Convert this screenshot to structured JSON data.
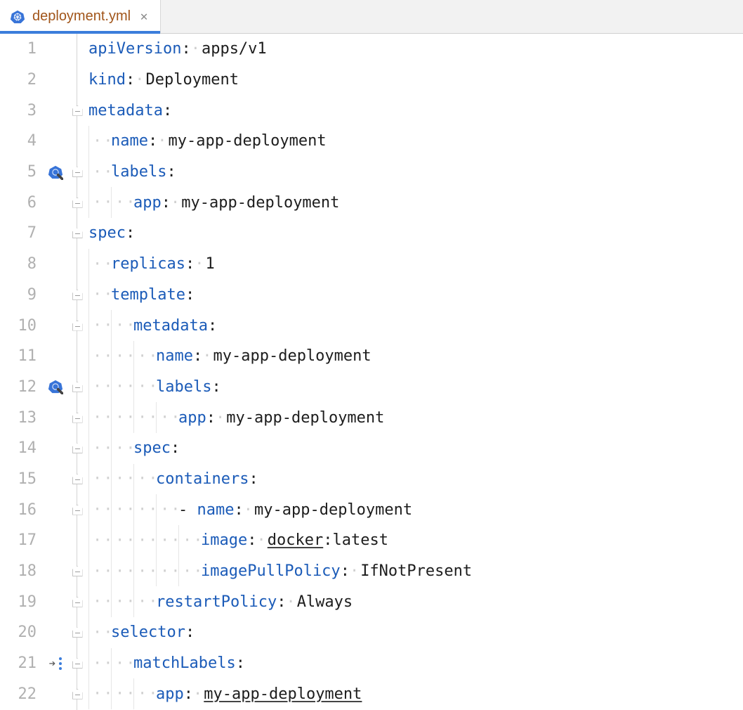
{
  "tab": {
    "filename": "deployment.yml"
  },
  "colors": {
    "key": "#1b5bb8",
    "accent": "#3b7ddb",
    "tab_label": "#a1551a"
  },
  "gutter_icons": {
    "5": "k8s-edit-icon",
    "12": "k8s-edit-icon",
    "21": "change-marker-icon"
  },
  "fold_handles_at": [
    3,
    5,
    6,
    7,
    9,
    10,
    12,
    13,
    14,
    15,
    16,
    18,
    19,
    20,
    21,
    22
  ],
  "lines": [
    {
      "n": 1,
      "indent": 0,
      "segs": [
        {
          "t": "key",
          "v": "apiVersion"
        },
        {
          "t": "punct",
          "v": ":"
        },
        {
          "t": "ws",
          "v": " "
        },
        {
          "t": "val",
          "v": "apps/v1"
        }
      ]
    },
    {
      "n": 2,
      "indent": 0,
      "segs": [
        {
          "t": "key",
          "v": "kind"
        },
        {
          "t": "punct",
          "v": ":"
        },
        {
          "t": "ws",
          "v": " "
        },
        {
          "t": "val",
          "v": "Deployment"
        }
      ]
    },
    {
      "n": 3,
      "indent": 0,
      "segs": [
        {
          "t": "key",
          "v": "metadata"
        },
        {
          "t": "punct",
          "v": ":"
        }
      ]
    },
    {
      "n": 4,
      "indent": 1,
      "segs": [
        {
          "t": "key",
          "v": "name"
        },
        {
          "t": "punct",
          "v": ":"
        },
        {
          "t": "ws",
          "v": " "
        },
        {
          "t": "val",
          "v": "my-app-deployment"
        }
      ]
    },
    {
      "n": 5,
      "indent": 1,
      "segs": [
        {
          "t": "key",
          "v": "labels"
        },
        {
          "t": "punct",
          "v": ":"
        }
      ]
    },
    {
      "n": 6,
      "indent": 2,
      "segs": [
        {
          "t": "key",
          "v": "app"
        },
        {
          "t": "punct",
          "v": ":"
        },
        {
          "t": "ws",
          "v": " "
        },
        {
          "t": "val",
          "v": "my-app-deployment"
        }
      ]
    },
    {
      "n": 7,
      "indent": 0,
      "segs": [
        {
          "t": "key",
          "v": "spec"
        },
        {
          "t": "punct",
          "v": ":"
        }
      ]
    },
    {
      "n": 8,
      "indent": 1,
      "segs": [
        {
          "t": "key",
          "v": "replicas"
        },
        {
          "t": "punct",
          "v": ":"
        },
        {
          "t": "ws",
          "v": " "
        },
        {
          "t": "val",
          "v": "1"
        }
      ]
    },
    {
      "n": 9,
      "indent": 1,
      "segs": [
        {
          "t": "key",
          "v": "template"
        },
        {
          "t": "punct",
          "v": ":"
        }
      ]
    },
    {
      "n": 10,
      "indent": 2,
      "segs": [
        {
          "t": "key",
          "v": "metadata"
        },
        {
          "t": "punct",
          "v": ":"
        }
      ]
    },
    {
      "n": 11,
      "indent": 3,
      "segs": [
        {
          "t": "key",
          "v": "name"
        },
        {
          "t": "punct",
          "v": ":"
        },
        {
          "t": "ws",
          "v": " "
        },
        {
          "t": "val",
          "v": "my-app-deployment"
        }
      ]
    },
    {
      "n": 12,
      "indent": 3,
      "segs": [
        {
          "t": "key",
          "v": "labels"
        },
        {
          "t": "punct",
          "v": ":"
        }
      ]
    },
    {
      "n": 13,
      "indent": 4,
      "segs": [
        {
          "t": "key",
          "v": "app"
        },
        {
          "t": "punct",
          "v": ":"
        },
        {
          "t": "ws",
          "v": " "
        },
        {
          "t": "val",
          "v": "my-app-deployment"
        }
      ]
    },
    {
      "n": 14,
      "indent": 2,
      "segs": [
        {
          "t": "key",
          "v": "spec"
        },
        {
          "t": "punct",
          "v": ":"
        }
      ]
    },
    {
      "n": 15,
      "indent": 3,
      "segs": [
        {
          "t": "key",
          "v": "containers"
        },
        {
          "t": "punct",
          "v": ":"
        }
      ]
    },
    {
      "n": 16,
      "indent": 4,
      "segs": [
        {
          "t": "dash",
          "v": "- "
        },
        {
          "t": "key",
          "v": "name"
        },
        {
          "t": "punct",
          "v": ":"
        },
        {
          "t": "ws",
          "v": " "
        },
        {
          "t": "val",
          "v": "my-app-deployment"
        }
      ]
    },
    {
      "n": 17,
      "indent": 5,
      "segs": [
        {
          "t": "key",
          "v": "image"
        },
        {
          "t": "punct",
          "v": ":"
        },
        {
          "t": "ws",
          "v": " "
        },
        {
          "t": "val-u",
          "v": "docker"
        },
        {
          "t": "val",
          "v": ":latest"
        }
      ]
    },
    {
      "n": 18,
      "indent": 5,
      "segs": [
        {
          "t": "key",
          "v": "imagePullPolicy"
        },
        {
          "t": "punct",
          "v": ":"
        },
        {
          "t": "ws",
          "v": " "
        },
        {
          "t": "val",
          "v": "IfNotPresent"
        }
      ]
    },
    {
      "n": 19,
      "indent": 3,
      "segs": [
        {
          "t": "key",
          "v": "restartPolicy"
        },
        {
          "t": "punct",
          "v": ":"
        },
        {
          "t": "ws",
          "v": " "
        },
        {
          "t": "val",
          "v": "Always"
        }
      ]
    },
    {
      "n": 20,
      "indent": 1,
      "segs": [
        {
          "t": "key",
          "v": "selector"
        },
        {
          "t": "punct",
          "v": ":"
        }
      ]
    },
    {
      "n": 21,
      "indent": 2,
      "segs": [
        {
          "t": "key",
          "v": "matchLabels"
        },
        {
          "t": "punct",
          "v": ":"
        }
      ]
    },
    {
      "n": 22,
      "indent": 3,
      "segs": [
        {
          "t": "key",
          "v": "app"
        },
        {
          "t": "punct",
          "v": ":"
        },
        {
          "t": "ws",
          "v": " "
        },
        {
          "t": "val-u",
          "v": "my-app-deployment"
        }
      ]
    }
  ]
}
